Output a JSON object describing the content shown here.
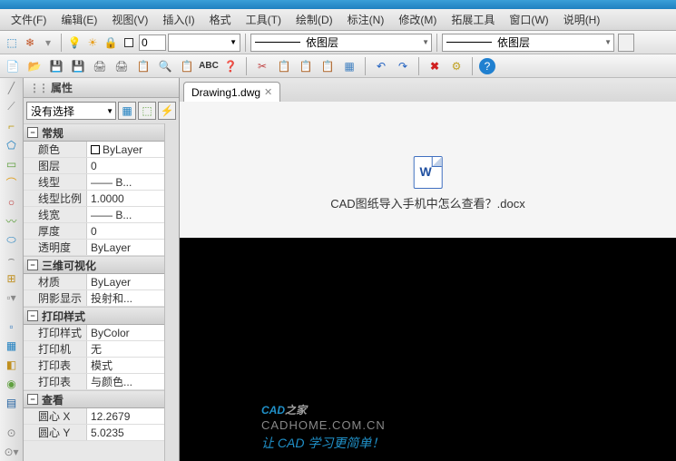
{
  "menubar": {
    "file": "文件(F)",
    "edit": "编辑(E)",
    "view": "视图(V)",
    "insert": "插入(I)",
    "format": "格式",
    "tools": "工具(T)",
    "draw": "绘制(D)",
    "annotate": "标注(N)",
    "modify": "修改(M)",
    "extend": "拓展工具",
    "window": "窗口(W)",
    "help": "说明(H)"
  },
  "layers": {
    "current": "0",
    "combo1": "依图层",
    "combo2": "依图层"
  },
  "tab": {
    "name": "Drawing1.dwg"
  },
  "props": {
    "title": "属性",
    "selector": "没有选择",
    "groups": {
      "general": "常规",
      "visual3d": "三维可视化",
      "print": "打印样式",
      "view": "查看"
    },
    "rows": {
      "color": {
        "label": "颜色",
        "value": "ByLayer"
      },
      "layer": {
        "label": "图层",
        "value": "0"
      },
      "linetype": {
        "label": "线型",
        "value": "—— B..."
      },
      "ltscale": {
        "label": "线型比例",
        "value": "1.0000"
      },
      "lineweight": {
        "label": "线宽",
        "value": "—— B..."
      },
      "thickness": {
        "label": "厚度",
        "value": "0"
      },
      "transparency": {
        "label": "透明度",
        "value": "ByLayer"
      },
      "material": {
        "label": "材质",
        "value": "ByLayer"
      },
      "shadow": {
        "label": "阴影显示",
        "value": "投射和..."
      },
      "plotstyle": {
        "label": "打印样式",
        "value": "ByColor"
      },
      "printer": {
        "label": "打印机",
        "value": "无"
      },
      "plottable1": {
        "label": "打印表",
        "value": "模式"
      },
      "plottable2": {
        "label": "打印表",
        "value": "与颜色..."
      },
      "centerx": {
        "label": "圆心 X",
        "value": "12.2679"
      },
      "centery": {
        "label": "圆心 Y",
        "value": "5.0235"
      }
    }
  },
  "file_on_canvas": {
    "label": "CAD图纸导入手机中怎么查看？.docx"
  },
  "watermark": {
    "brand_a": "CAD",
    "brand_b": "之家",
    "url": "CADHOME.COM.CN",
    "slogan": "让 CAD 学习更简单！"
  }
}
